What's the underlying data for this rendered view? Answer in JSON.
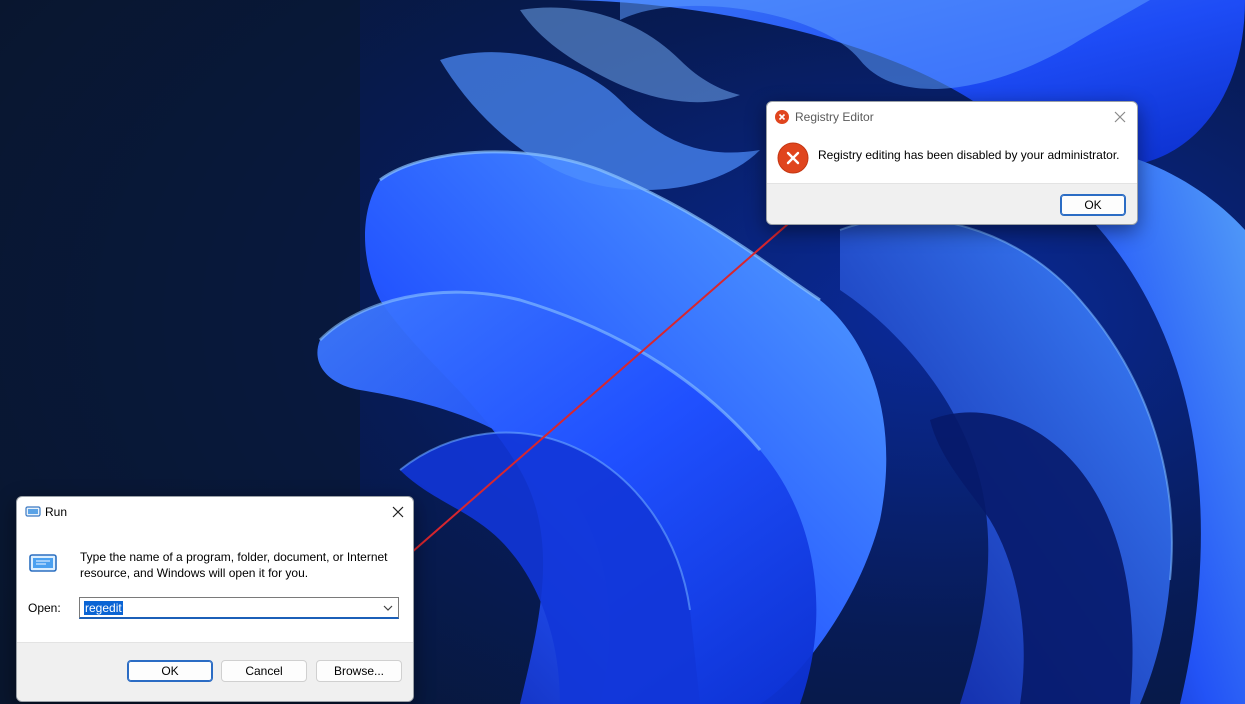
{
  "registry_dialog": {
    "title": "Registry Editor",
    "message": "Registry editing has been disabled by your administrator.",
    "ok_label": "OK",
    "icon": "error-icon"
  },
  "run_dialog": {
    "title": "Run",
    "description": "Type the name of a program, folder, document, or Internet resource, and Windows will open it for you.",
    "open_label": "Open:",
    "input_value": "regedit",
    "ok_label": "OK",
    "cancel_label": "Cancel",
    "browse_label": "Browse...",
    "icon": "run-icon"
  },
  "colors": {
    "error_red": "#e0451e",
    "annotation_arrow": "#d8262e",
    "selection_blue": "#0a64d4",
    "wallpaper_blue": "#1f4fff"
  }
}
